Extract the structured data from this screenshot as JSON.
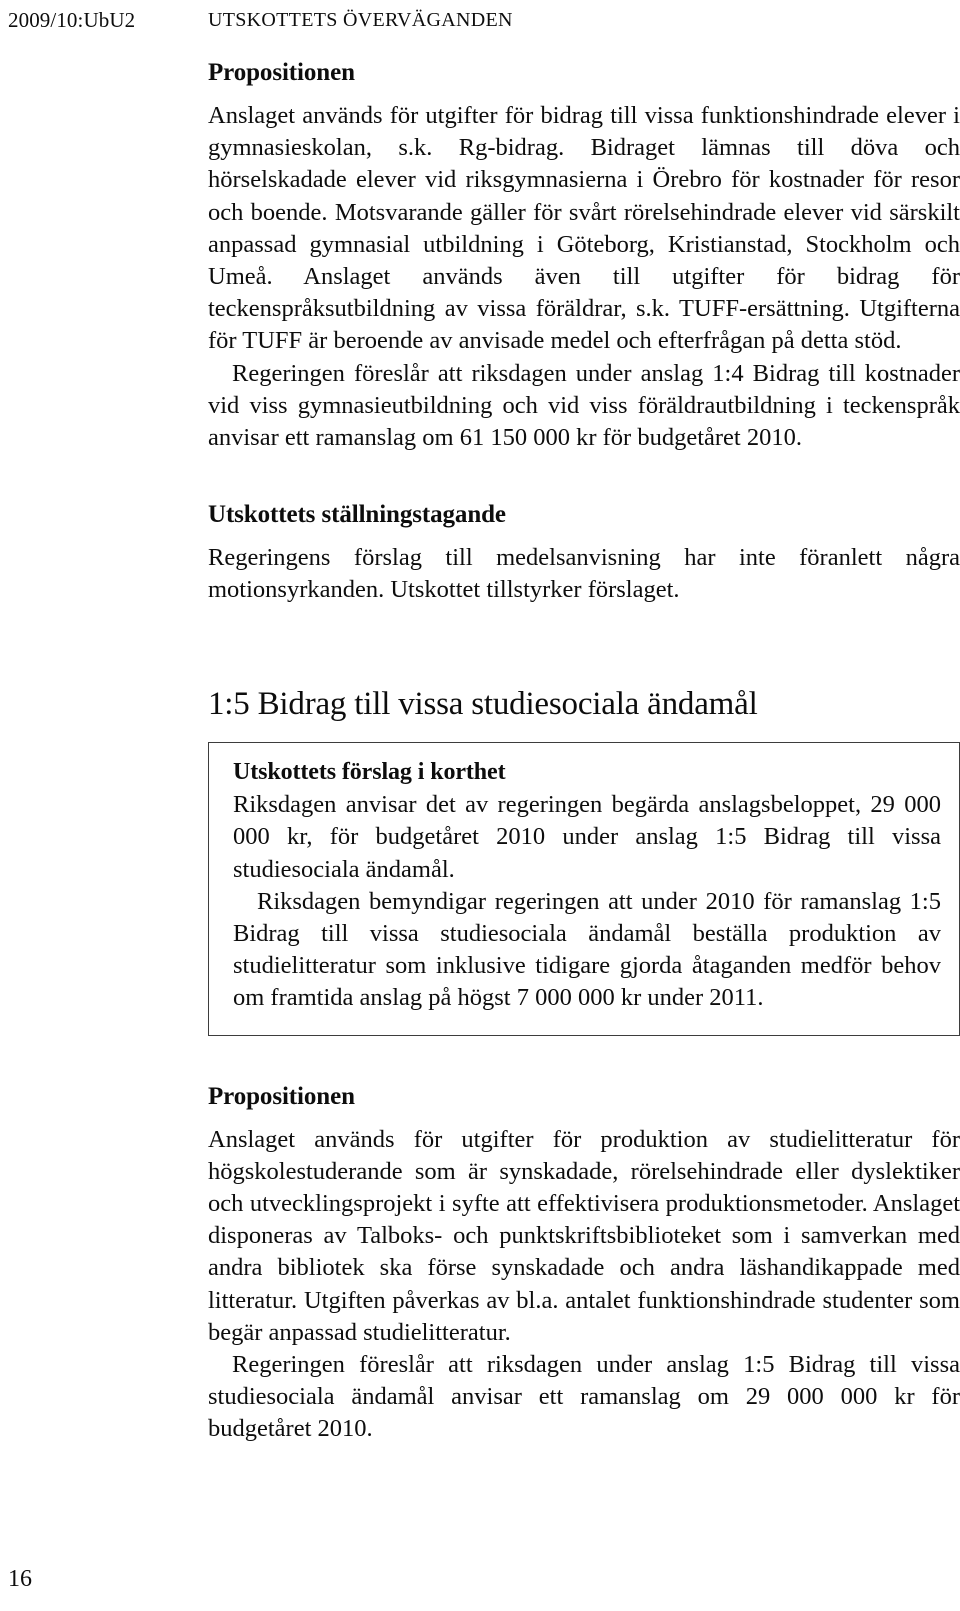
{
  "header": {
    "document_id": "2009/10:UbU2",
    "section_title": "UTSKOTTETS ÖVERVÄGANDEN"
  },
  "footer": {
    "page_number": "16"
  },
  "content": {
    "proposition_1_heading": "Propositionen",
    "proposition_1_para_1": "Anslaget används för utgifter för bidrag till vissa funktionshindrade elever i gymnasieskolan, s.k. Rg-bidrag. Bidraget lämnas till döva och hörselskadade elever vid riksgymnasierna i Örebro för kostnader för resor och boende. Motsvarande gäller för svårt rörelsehindrade elever vid särskilt anpassad gymnasial utbildning i Göteborg, Kristianstad, Stockholm och Umeå. Anslaget används även till utgifter för bidrag för teckenspråksutbildning av vissa föräldrar, s.k. TUFF-ersättning. Utgifterna för TUFF är beroende av anvisade medel och efterfrågan på detta stöd.",
    "proposition_1_para_2": "Regeringen föreslår att riksdagen under anslag 1:4 Bidrag till kostnader vid viss gymnasieutbildning och vid viss föräldrautbildning i teckenspråk anvisar ett ramanslag om 61 150 000 kr för budgetåret 2010.",
    "stallningstagande_heading": "Utskottets ställningstagande",
    "stallningstagande_para": "Regeringens förslag till medelsanvisning har inte föranlett några motionsyrkanden. Utskottet tillstyrker förslaget.",
    "section_heading": "1:5 Bidrag till vissa studiesociala ändamål",
    "box": {
      "heading": "Utskottets förslag i korthet",
      "para_1": "Riksdagen anvisar det av regeringen begärda anslagsbeloppet, 29 000 000 kr, för budgetåret 2010 under anslag 1:5 Bidrag till vissa studiesociala ändamål.",
      "para_2": "Riksdagen bemyndigar regeringen att under 2010 för ramanslag 1:5 Bidrag till vissa studiesociala ändamål beställa produktion av studielitteratur som inklusive tidigare gjorda åtaganden medför behov om framtida anslag på högst 7 000 000 kr under 2011."
    },
    "proposition_2_heading": "Propositionen",
    "proposition_2_para_1": "Anslaget används för utgifter för produktion av studielitteratur för högskolestuderande som är synskadade, rörelsehindrade eller dyslektiker och utvecklingsprojekt i syfte att effektivisera produktionsmetoder. Anslaget disponeras av Talboks- och punktskriftsbiblioteket som i samverkan med andra bibliotek ska förse synskadade och andra läshandikappade med litteratur. Utgiften påverkas av bl.a. antalet funktionshindrade studenter som begär anpassad studielitteratur.",
    "proposition_2_para_2": "Regeringen föreslår att riksdagen under anslag 1:5 Bidrag till vissa studiesociala ändamål anvisar ett ramanslag om 29 000 000 kr för budgetåret 2010."
  }
}
